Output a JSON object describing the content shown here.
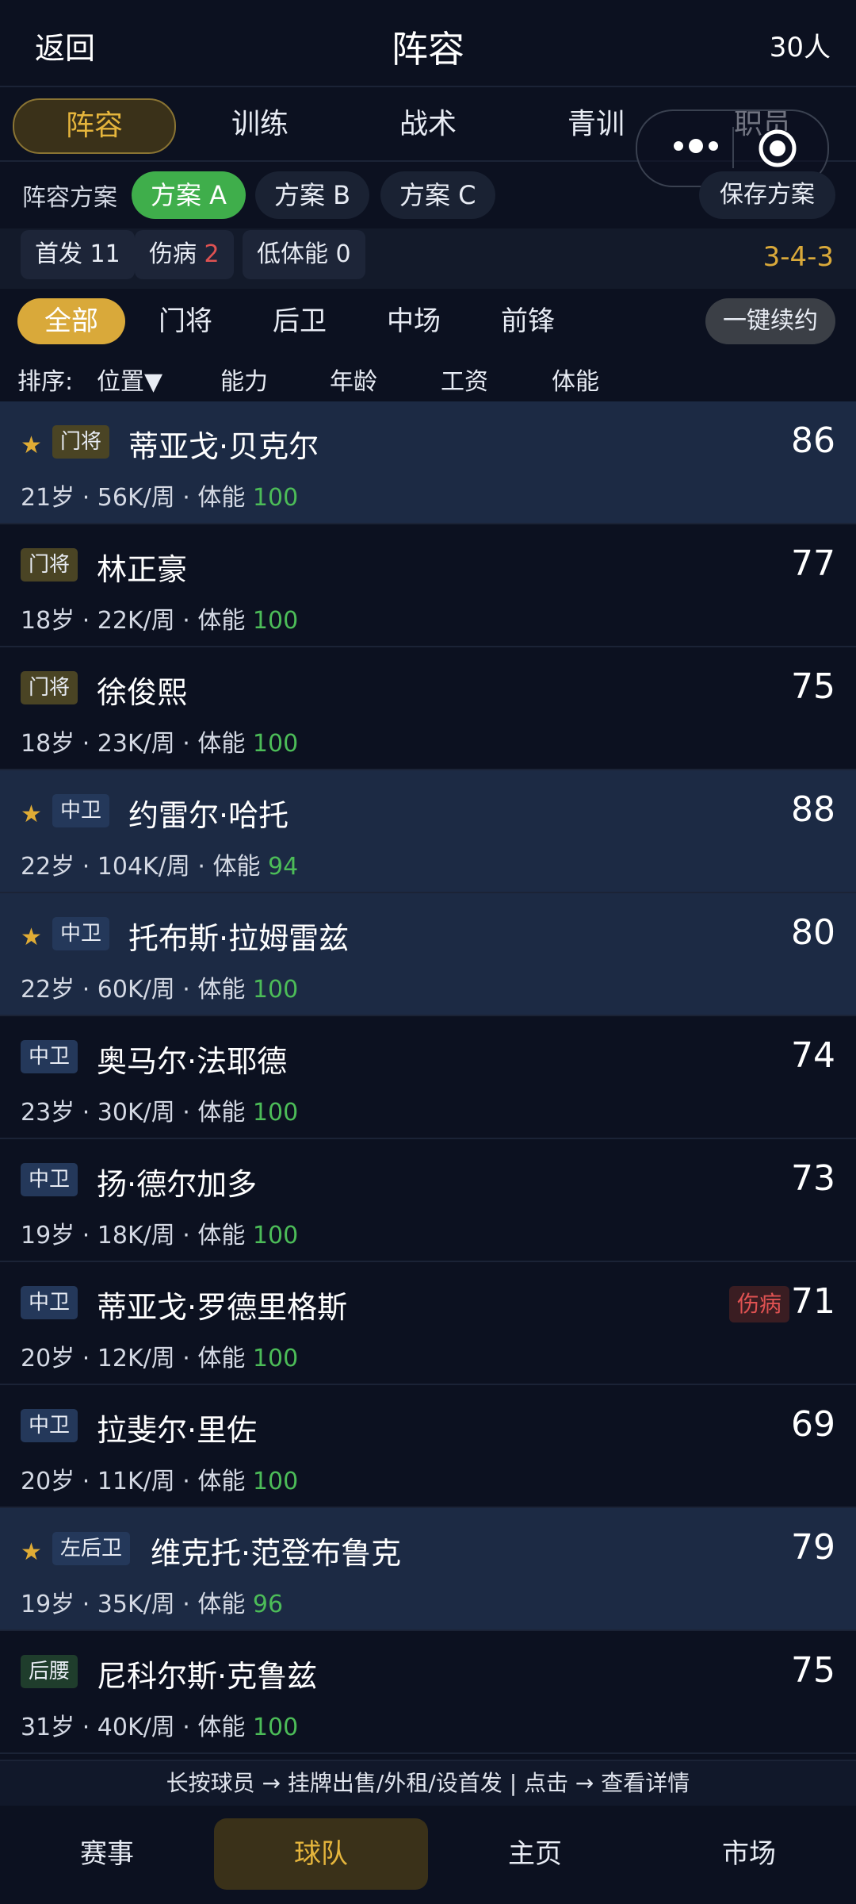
{
  "header": {
    "back_label": "返回",
    "title": "阵容",
    "count": "30人"
  },
  "tabs": [
    {
      "label": "阵容",
      "active": true
    },
    {
      "label": "训练"
    },
    {
      "label": "战术"
    },
    {
      "label": "青训"
    },
    {
      "label": "职员"
    }
  ],
  "plans": {
    "label": "阵容方案",
    "items": [
      {
        "label": "方案 A",
        "active": true
      },
      {
        "label": "方案 B"
      },
      {
        "label": "方案 C"
      }
    ],
    "save_label": "保存方案"
  },
  "stats": {
    "starters_label": "首发",
    "starters": "11",
    "injured_label": "伤病",
    "injured": "2",
    "low_stamina_label": "低体能",
    "low_stamina": "0",
    "formation": "3-4-3"
  },
  "filters": {
    "items": [
      {
        "label": "全部",
        "active": true
      },
      {
        "label": "门将"
      },
      {
        "label": "后卫"
      },
      {
        "label": "中场"
      },
      {
        "label": "前锋"
      }
    ],
    "renew_label": "一键续约"
  },
  "sort": {
    "label": "排序:",
    "items": [
      "位置▼",
      "能力",
      "年龄",
      "工资",
      "体能"
    ]
  },
  "players": [
    {
      "star": true,
      "position": "门将",
      "pos_type": "gk",
      "name": "蒂亚戈·贝克尔",
      "rating": "86",
      "age": "21岁",
      "wage": "56K/周",
      "stamina_label": "体能",
      "stamina": "100"
    },
    {
      "star": false,
      "position": "门将",
      "pos_type": "gk",
      "name": "林正豪",
      "rating": "77",
      "age": "18岁",
      "wage": "22K/周",
      "stamina_label": "体能",
      "stamina": "100"
    },
    {
      "star": false,
      "position": "门将",
      "pos_type": "gk",
      "name": "徐俊熙",
      "rating": "75",
      "age": "18岁",
      "wage": "23K/周",
      "stamina_label": "体能",
      "stamina": "100"
    },
    {
      "star": true,
      "position": "中卫",
      "pos_type": "def",
      "name": "约雷尔·哈托",
      "rating": "88",
      "age": "22岁",
      "wage": "104K/周",
      "stamina_label": "体能",
      "stamina": "94"
    },
    {
      "star": true,
      "position": "中卫",
      "pos_type": "def",
      "name": "托布斯·拉姆雷兹",
      "rating": "80",
      "age": "22岁",
      "wage": "60K/周",
      "stamina_label": "体能",
      "stamina": "100"
    },
    {
      "star": false,
      "position": "中卫",
      "pos_type": "def",
      "name": "奥马尔·法耶德",
      "rating": "74",
      "age": "23岁",
      "wage": "30K/周",
      "stamina_label": "体能",
      "stamina": "100"
    },
    {
      "star": false,
      "position": "中卫",
      "pos_type": "def",
      "name": "扬·德尔加多",
      "rating": "73",
      "age": "19岁",
      "wage": "18K/周",
      "stamina_label": "体能",
      "stamina": "100"
    },
    {
      "star": false,
      "position": "中卫",
      "pos_type": "def",
      "name": "蒂亚戈·罗德里格斯",
      "rating": "71",
      "age": "20岁",
      "wage": "12K/周",
      "stamina_label": "体能",
      "stamina": "100",
      "injury": "伤病"
    },
    {
      "star": false,
      "position": "中卫",
      "pos_type": "def",
      "name": "拉斐尔·里佐",
      "rating": "69",
      "age": "20岁",
      "wage": "11K/周",
      "stamina_label": "体能",
      "stamina": "100"
    },
    {
      "star": true,
      "position": "左后卫",
      "pos_type": "def",
      "name": "维克托·范登布鲁克",
      "rating": "79",
      "age": "19岁",
      "wage": "35K/周",
      "stamina_label": "体能",
      "stamina": "96"
    },
    {
      "star": false,
      "position": "后腰",
      "pos_type": "mid",
      "name": "尼科尔斯·克鲁兹",
      "rating": "75",
      "age": "31岁",
      "wage": "40K/周",
      "stamina_label": "体能",
      "stamina": "100"
    }
  ],
  "hint": "长按球员 → 挂牌出售/外租/设首发 | 点击 → 查看详情",
  "nav": [
    {
      "label": "赛事"
    },
    {
      "label": "球队",
      "active": true
    },
    {
      "label": "主页"
    },
    {
      "label": "市场"
    }
  ],
  "colors": {
    "background": "#0c1120",
    "starter_row": "#1c2a44",
    "accent_gold": "#d9a93a",
    "plan_active": "#3fae4b",
    "stamina_green": "#4cbc58",
    "injury_red": "#e05252",
    "gk_badge": "#4a4424",
    "def_badge": "#24385a",
    "mid_badge": "#1f3d2c"
  }
}
